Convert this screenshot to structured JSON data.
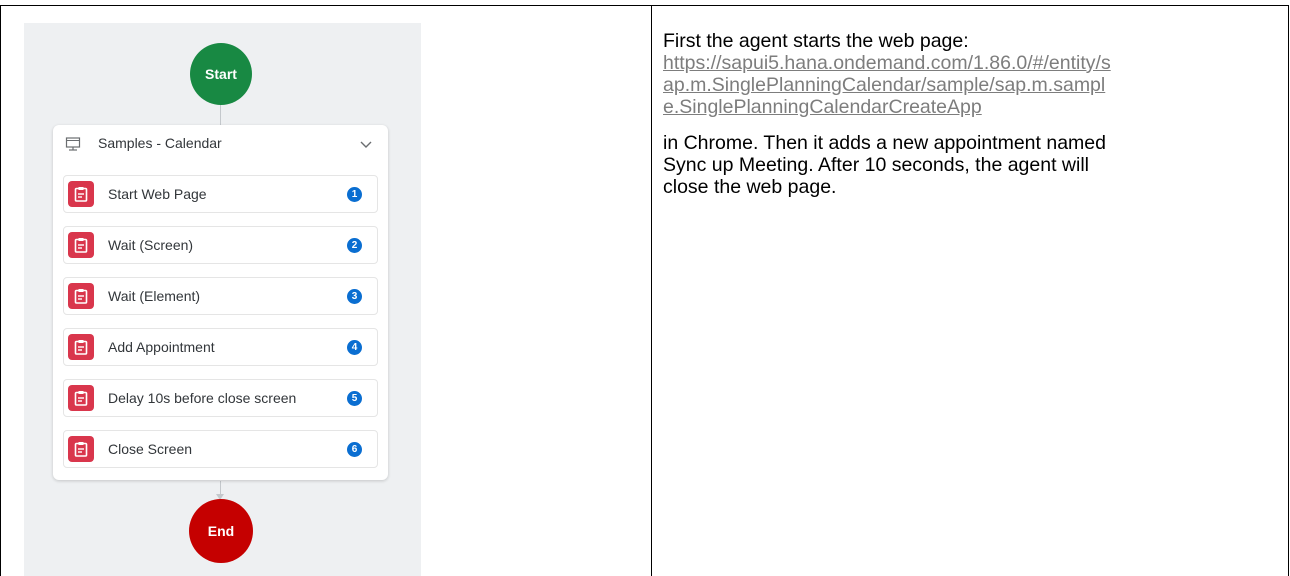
{
  "workflow": {
    "start_label": "Start",
    "end_label": "End",
    "group": {
      "icon": "screen-icon",
      "title": "Samples - Calendar",
      "collapse_icon": "chevron-down-icon",
      "steps": [
        {
          "label": "Start Web Page",
          "number": "1",
          "icon": "clipboard-icon"
        },
        {
          "label": "Wait (Screen)",
          "number": "2",
          "icon": "clipboard-icon"
        },
        {
          "label": "Wait (Element)",
          "number": "3",
          "icon": "clipboard-icon"
        },
        {
          "label": "Add Appointment",
          "number": "4",
          "icon": "clipboard-icon"
        },
        {
          "label": "Delay 10s before close screen",
          "number": "5",
          "icon": "clipboard-icon"
        },
        {
          "label": "Close Screen",
          "number": "6",
          "icon": "clipboard-icon"
        }
      ]
    },
    "colors": {
      "start": "#188943",
      "end": "#c50000",
      "step_icon": "#d9364c",
      "step_number": "#0a6ed1"
    }
  },
  "description": {
    "line1": "First the agent starts the web page:",
    "url_lines": [
      "https://sapui5.hana.ondemand.com/1.86.0/#/entity/s",
      "ap.m.SinglePlanningCalendar/sample/sap.m.sampl",
      "e.SinglePlanningCalendarCreateApp"
    ],
    "para_lines": [
      "in Chrome. Then it adds a new appointment named",
      "Sync up Meeting. After 10 seconds, the agent will",
      "close the web page."
    ]
  }
}
